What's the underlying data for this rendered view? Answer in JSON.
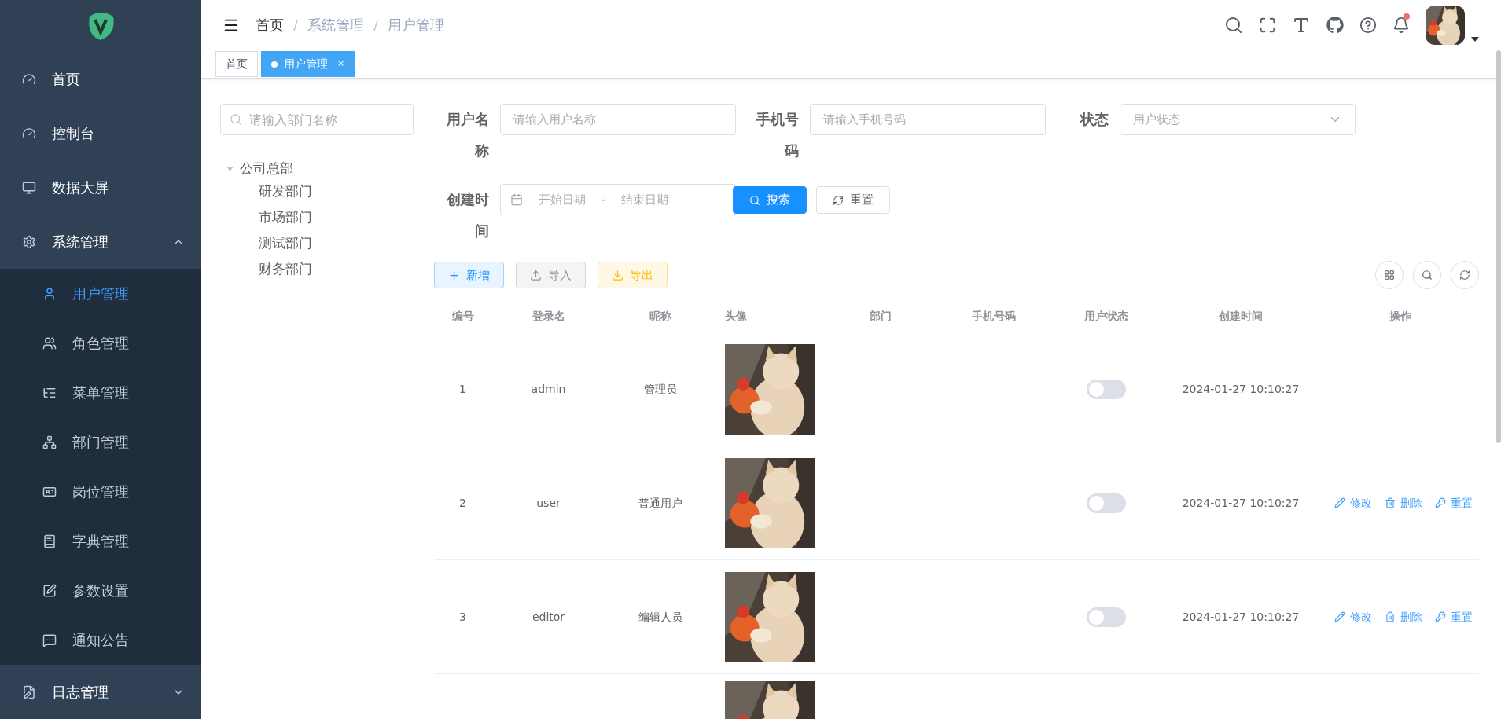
{
  "sidebar": {
    "items": [
      {
        "label": "首页",
        "kind": "link",
        "selected": false
      },
      {
        "label": "控制台",
        "kind": "link",
        "selected": false
      },
      {
        "label": "数据大屏",
        "kind": "link",
        "selected": false
      },
      {
        "label": "系统管理",
        "kind": "group",
        "selected": false,
        "expanded": true,
        "children": [
          {
            "label": "用户管理",
            "selected": true
          },
          {
            "label": "角色管理",
            "selected": false
          },
          {
            "label": "菜单管理",
            "selected": false
          },
          {
            "label": "部门管理",
            "selected": false
          },
          {
            "label": "岗位管理",
            "selected": false
          },
          {
            "label": "字典管理",
            "selected": false
          },
          {
            "label": "参数设置",
            "selected": false
          },
          {
            "label": "通知公告",
            "selected": false
          }
        ]
      },
      {
        "label": "日志管理",
        "kind": "group",
        "selected": false,
        "expanded": false
      }
    ]
  },
  "header": {
    "breadcrumb": [
      "首页",
      "系统管理",
      "用户管理"
    ],
    "breadcrumb_separator": "/",
    "has_unread": true,
    "avatar": {
      "kind": "picture"
    }
  },
  "tags": [
    {
      "label": "首页",
      "selected": false
    },
    {
      "label": "用户管理",
      "selected": true,
      "close": "×"
    }
  ],
  "dept_panel": {
    "search": {
      "placeholder": "请输入部门名称"
    },
    "tree": [
      {
        "label": "公司总部",
        "expanded": true,
        "children": [
          {
            "label": "研发部门"
          },
          {
            "label": "市场部门"
          },
          {
            "label": "测试部门"
          },
          {
            "label": "财务部门"
          }
        ]
      }
    ]
  },
  "filters": [
    {
      "label": "用户名称",
      "kind": "text",
      "placeholder": "请输入用户名称"
    },
    {
      "label": "手机号码",
      "kind": "text",
      "placeholder": "请输入手机号码"
    },
    {
      "label": "状态",
      "kind": "select",
      "placeholder": "用户状态"
    },
    {
      "label": "创建时间",
      "kind": "daterange",
      "start_placeholder": "开始日期",
      "separator": "-",
      "end_placeholder": "结束日期"
    }
  ],
  "filter_buttons": [
    {
      "label": "搜索",
      "kind": "primary"
    },
    {
      "label": "重置",
      "kind": "default"
    }
  ],
  "toolbar": [
    {
      "label": "新增",
      "kind": "add"
    },
    {
      "label": "导入",
      "kind": "import"
    },
    {
      "label": "导出",
      "kind": "export"
    }
  ],
  "table": {
    "columns": [
      "编号",
      "登录名",
      "昵称",
      "头像",
      "部门",
      "手机号码",
      "用户状态",
      "创建时间",
      "操作"
    ],
    "rows": [
      {
        "kind": "full",
        "id": "1",
        "username": "admin",
        "nickname": "管理员",
        "avatar": {
          "kind": "picture"
        },
        "enabled": false,
        "created": "2024-01-27 10:10:27"
      },
      {
        "kind": "full",
        "id": "2",
        "username": "user",
        "nickname": "普通用户",
        "avatar": {
          "kind": "picture"
        },
        "enabled": false,
        "created": "2024-01-27 10:10:27",
        "actions": [
          {
            "label": "修改",
            "kind": "edit"
          },
          {
            "label": "删除",
            "kind": "delete"
          },
          {
            "label": "重置",
            "kind": "reset"
          }
        ]
      },
      {
        "kind": "full",
        "id": "3",
        "username": "editor",
        "nickname": "编辑人员",
        "avatar": {
          "kind": "picture"
        },
        "enabled": false,
        "created": "2024-01-27 10:10:27",
        "actions": [
          {
            "label": "修改",
            "kind": "edit"
          },
          {
            "label": "删除",
            "kind": "delete"
          },
          {
            "label": "重置",
            "kind": "reset"
          }
        ]
      },
      {
        "kind": "partial",
        "avatar": {
          "kind": "picture"
        }
      }
    ]
  }
}
